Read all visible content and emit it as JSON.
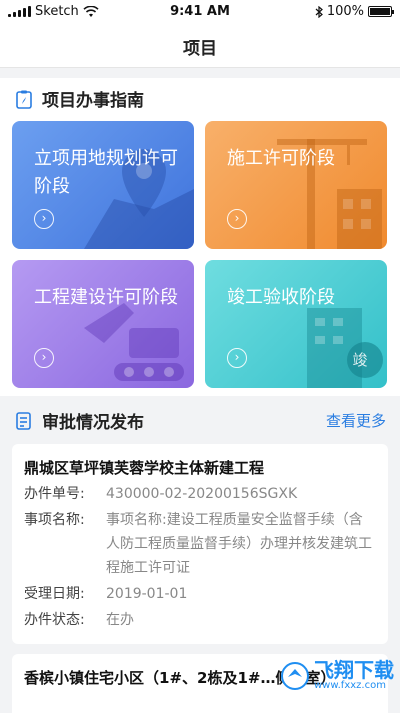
{
  "status_bar": {
    "carrier": "Sketch",
    "time": "9:41 AM",
    "battery": "100%"
  },
  "nav": {
    "title": "项目"
  },
  "guide": {
    "heading": "项目办事指南",
    "cards": [
      {
        "label": "立项用地规划许可阶段",
        "arrow": "›",
        "color": "#4f86e6"
      },
      {
        "label": "施工许可阶段",
        "arrow": "›",
        "color": "#f39a44"
      },
      {
        "label": "工程建设许可阶段",
        "arrow": "›",
        "color": "#9d7de8"
      },
      {
        "label": "竣工验收阶段",
        "arrow": "›",
        "color": "#45c8d0",
        "badge": "竣"
      }
    ]
  },
  "approval": {
    "heading": "审批情况发布",
    "more_label": "查看更多",
    "items": [
      {
        "title": "鼎城区草坪镇芙蓉学校主体新建工程",
        "fields": [
          {
            "label": "办件单号:",
            "value": "430000-02-20200156SGXK"
          },
          {
            "label": "事项名称:",
            "value": "事项名称:建设工程质量安全监督手续（含人防工程质量监督手续）办理并核发建筑工程施工许可证"
          },
          {
            "label": "受理日期:",
            "value": "2019-01-01"
          },
          {
            "label": "办件状态:",
            "value": "在办"
          }
        ]
      },
      {
        "title": "香槟小镇住宅小区（1#、2栋及1#…侧地室）"
      }
    ]
  },
  "watermark": {
    "text": "飞翔下载",
    "sub": "www.fxxz.com"
  }
}
